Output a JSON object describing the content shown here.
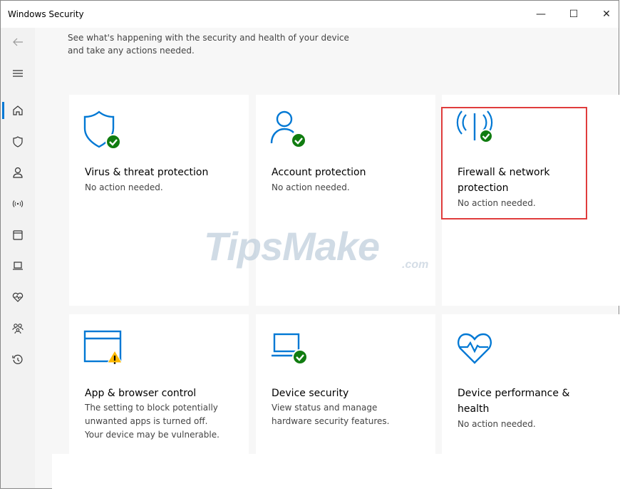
{
  "window": {
    "title": "Windows Security",
    "minimize_glyph": "—",
    "maximize_glyph": "☐",
    "close_glyph": "✕"
  },
  "sidebar": {
    "items": [
      {
        "name": "back-icon"
      },
      {
        "name": "menu-icon"
      },
      {
        "name": "home-icon",
        "active": true
      },
      {
        "name": "shield-icon"
      },
      {
        "name": "person-icon"
      },
      {
        "name": "wireless-icon"
      },
      {
        "name": "app-window-icon"
      },
      {
        "name": "laptop-icon"
      },
      {
        "name": "heart-pulse-icon"
      },
      {
        "name": "family-icon"
      },
      {
        "name": "history-icon"
      }
    ]
  },
  "main": {
    "intro_line1": "See what's happening with the security and health of your device",
    "intro_line2": "and take any actions needed."
  },
  "tiles": [
    {
      "title": "Virus & threat protection",
      "desc": "No action needed.",
      "icon": "shield-check-icon",
      "status": "ok"
    },
    {
      "title": "Account protection",
      "desc": "No action needed.",
      "icon": "account-check-icon",
      "status": "ok"
    },
    {
      "title_line1": "Firewall & network",
      "title_line2": "protection",
      "desc": "No action needed.",
      "icon": "wireless-check-icon",
      "status": "ok"
    },
    {
      "title": "App & browser control",
      "desc_line1": "The setting to block potentially",
      "desc_line2": "unwanted apps is turned off.",
      "desc_line3": "Your device may be vulnerable.",
      "icon": "browser-warning-icon",
      "status": "warning"
    },
    {
      "title": "Device security",
      "desc_line1": "View status and manage",
      "desc_line2": "hardware security features.",
      "icon": "laptop-check-icon",
      "status": "ok"
    },
    {
      "title_line1": "Device performance &",
      "title_line2": "health",
      "desc": "No action needed.",
      "icon": "heart-pulse-icon",
      "status": "ok"
    }
  ],
  "watermark": {
    "main": "TipsMake",
    "suffix": ".com"
  },
  "colors": {
    "accent": "#0078d4",
    "ok": "#107c10",
    "warning": "#ffb900",
    "highlight": "#e03c3c"
  }
}
